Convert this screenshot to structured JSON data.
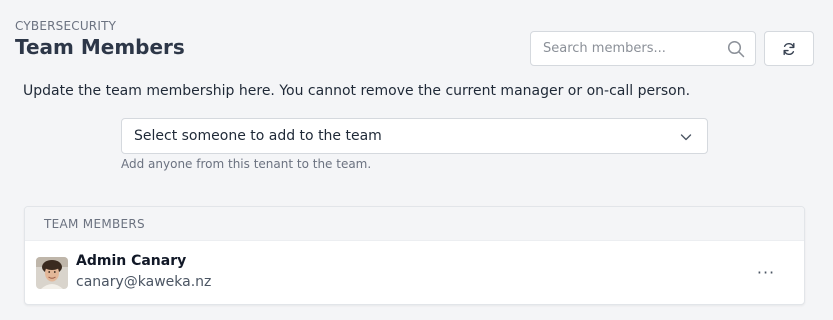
{
  "header": {
    "eyebrow": "CYBERSECURITY",
    "title": "Team Members"
  },
  "search": {
    "placeholder": "Search members...",
    "icon": "search-icon"
  },
  "refresh": {
    "icon": "refresh-icon"
  },
  "description": "Update the team membership here. You cannot remove the current manager or on-call person.",
  "add_member": {
    "selected": "Select someone to add to the team",
    "hint": "Add anyone from this tenant to the team."
  },
  "members_card": {
    "header": "TEAM MEMBERS",
    "members": [
      {
        "name": "Admin Canary",
        "email": "canary@kaweka.nz",
        "more": "···"
      }
    ]
  },
  "colors": {
    "background": "#f4f5f7",
    "border": "#d5d9de",
    "text": "#1f2937",
    "muted": "#6b7280"
  }
}
